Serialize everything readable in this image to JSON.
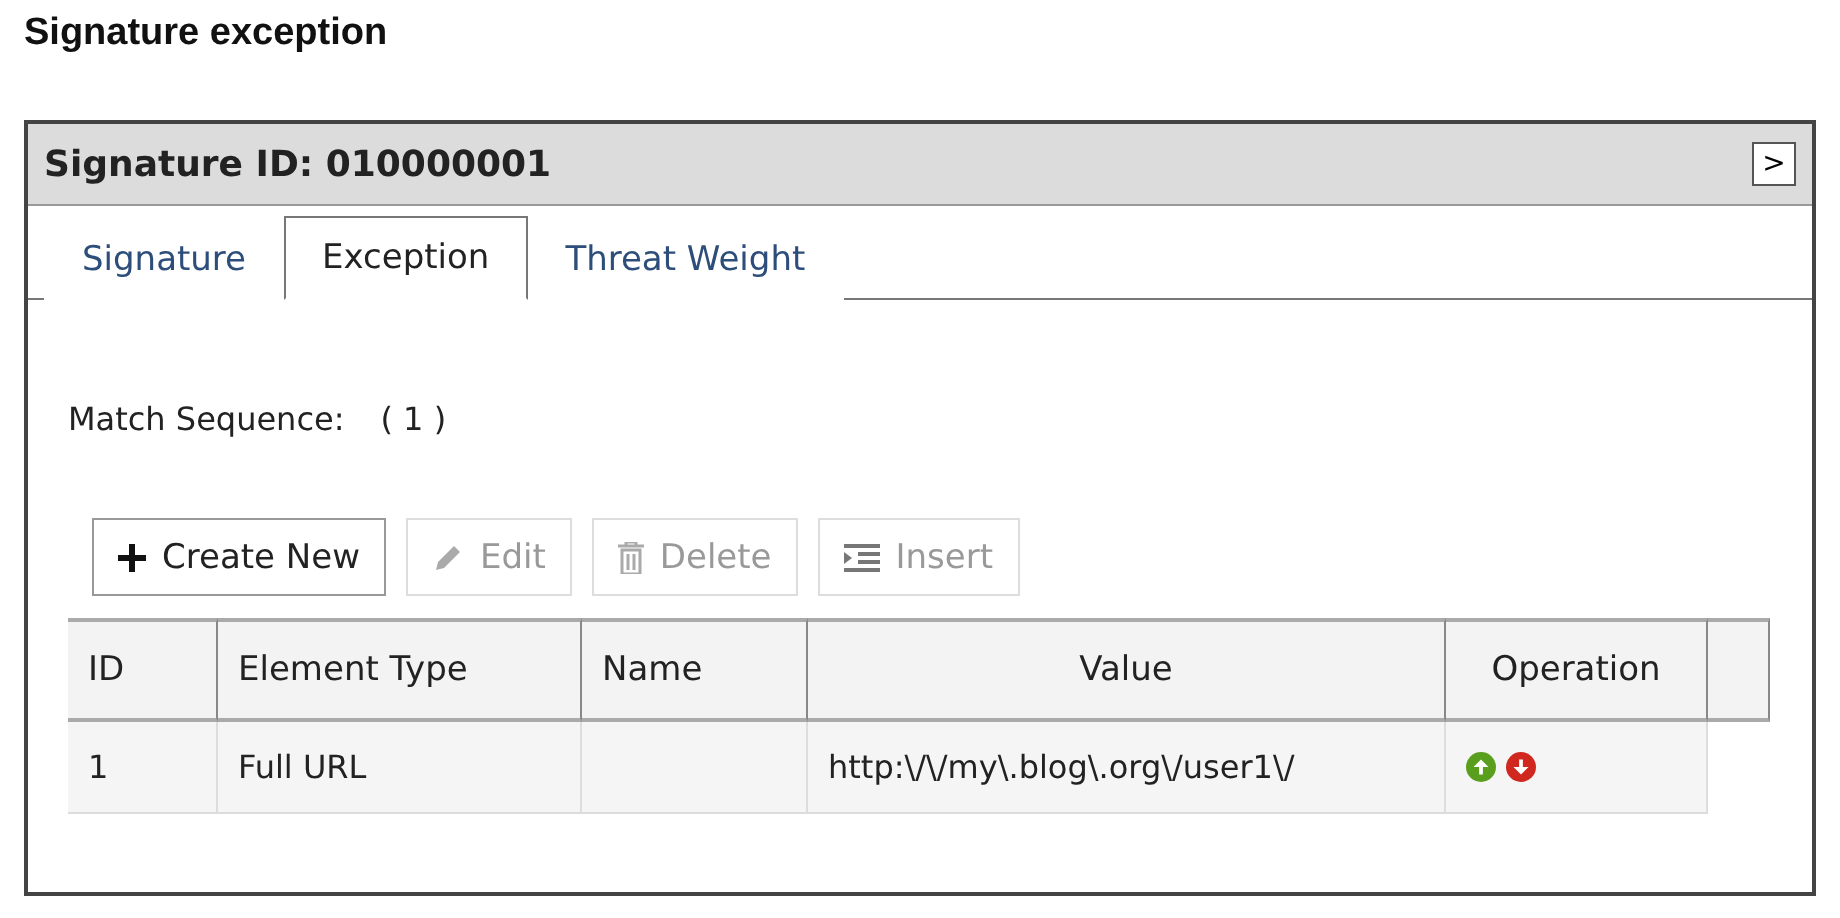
{
  "heading": "Signature exception",
  "panel": {
    "title": "Signature ID: 010000001",
    "expand_button": ">"
  },
  "tabs": [
    {
      "label": "Signature",
      "selected": false
    },
    {
      "label": "Exception",
      "selected": true
    },
    {
      "label": "Threat Weight",
      "selected": false
    }
  ],
  "match_sequence": {
    "label": "Match Sequence:",
    "value": "( 1 )"
  },
  "toolbar": [
    {
      "kind": "create",
      "label": "Create New",
      "disabled": false
    },
    {
      "kind": "edit",
      "label": "Edit",
      "disabled": true
    },
    {
      "kind": "delete",
      "label": "Delete",
      "disabled": true
    },
    {
      "kind": "insert",
      "label": "Insert",
      "disabled": true
    }
  ],
  "table": {
    "columns": [
      "ID",
      "Element Type",
      "Name",
      "Value",
      "Operation"
    ],
    "rows": [
      {
        "id": "1",
        "element_type": "Full URL",
        "name": "",
        "value": "http:\\/\\/my\\.blog\\.org\\/user1\\/"
      }
    ]
  }
}
